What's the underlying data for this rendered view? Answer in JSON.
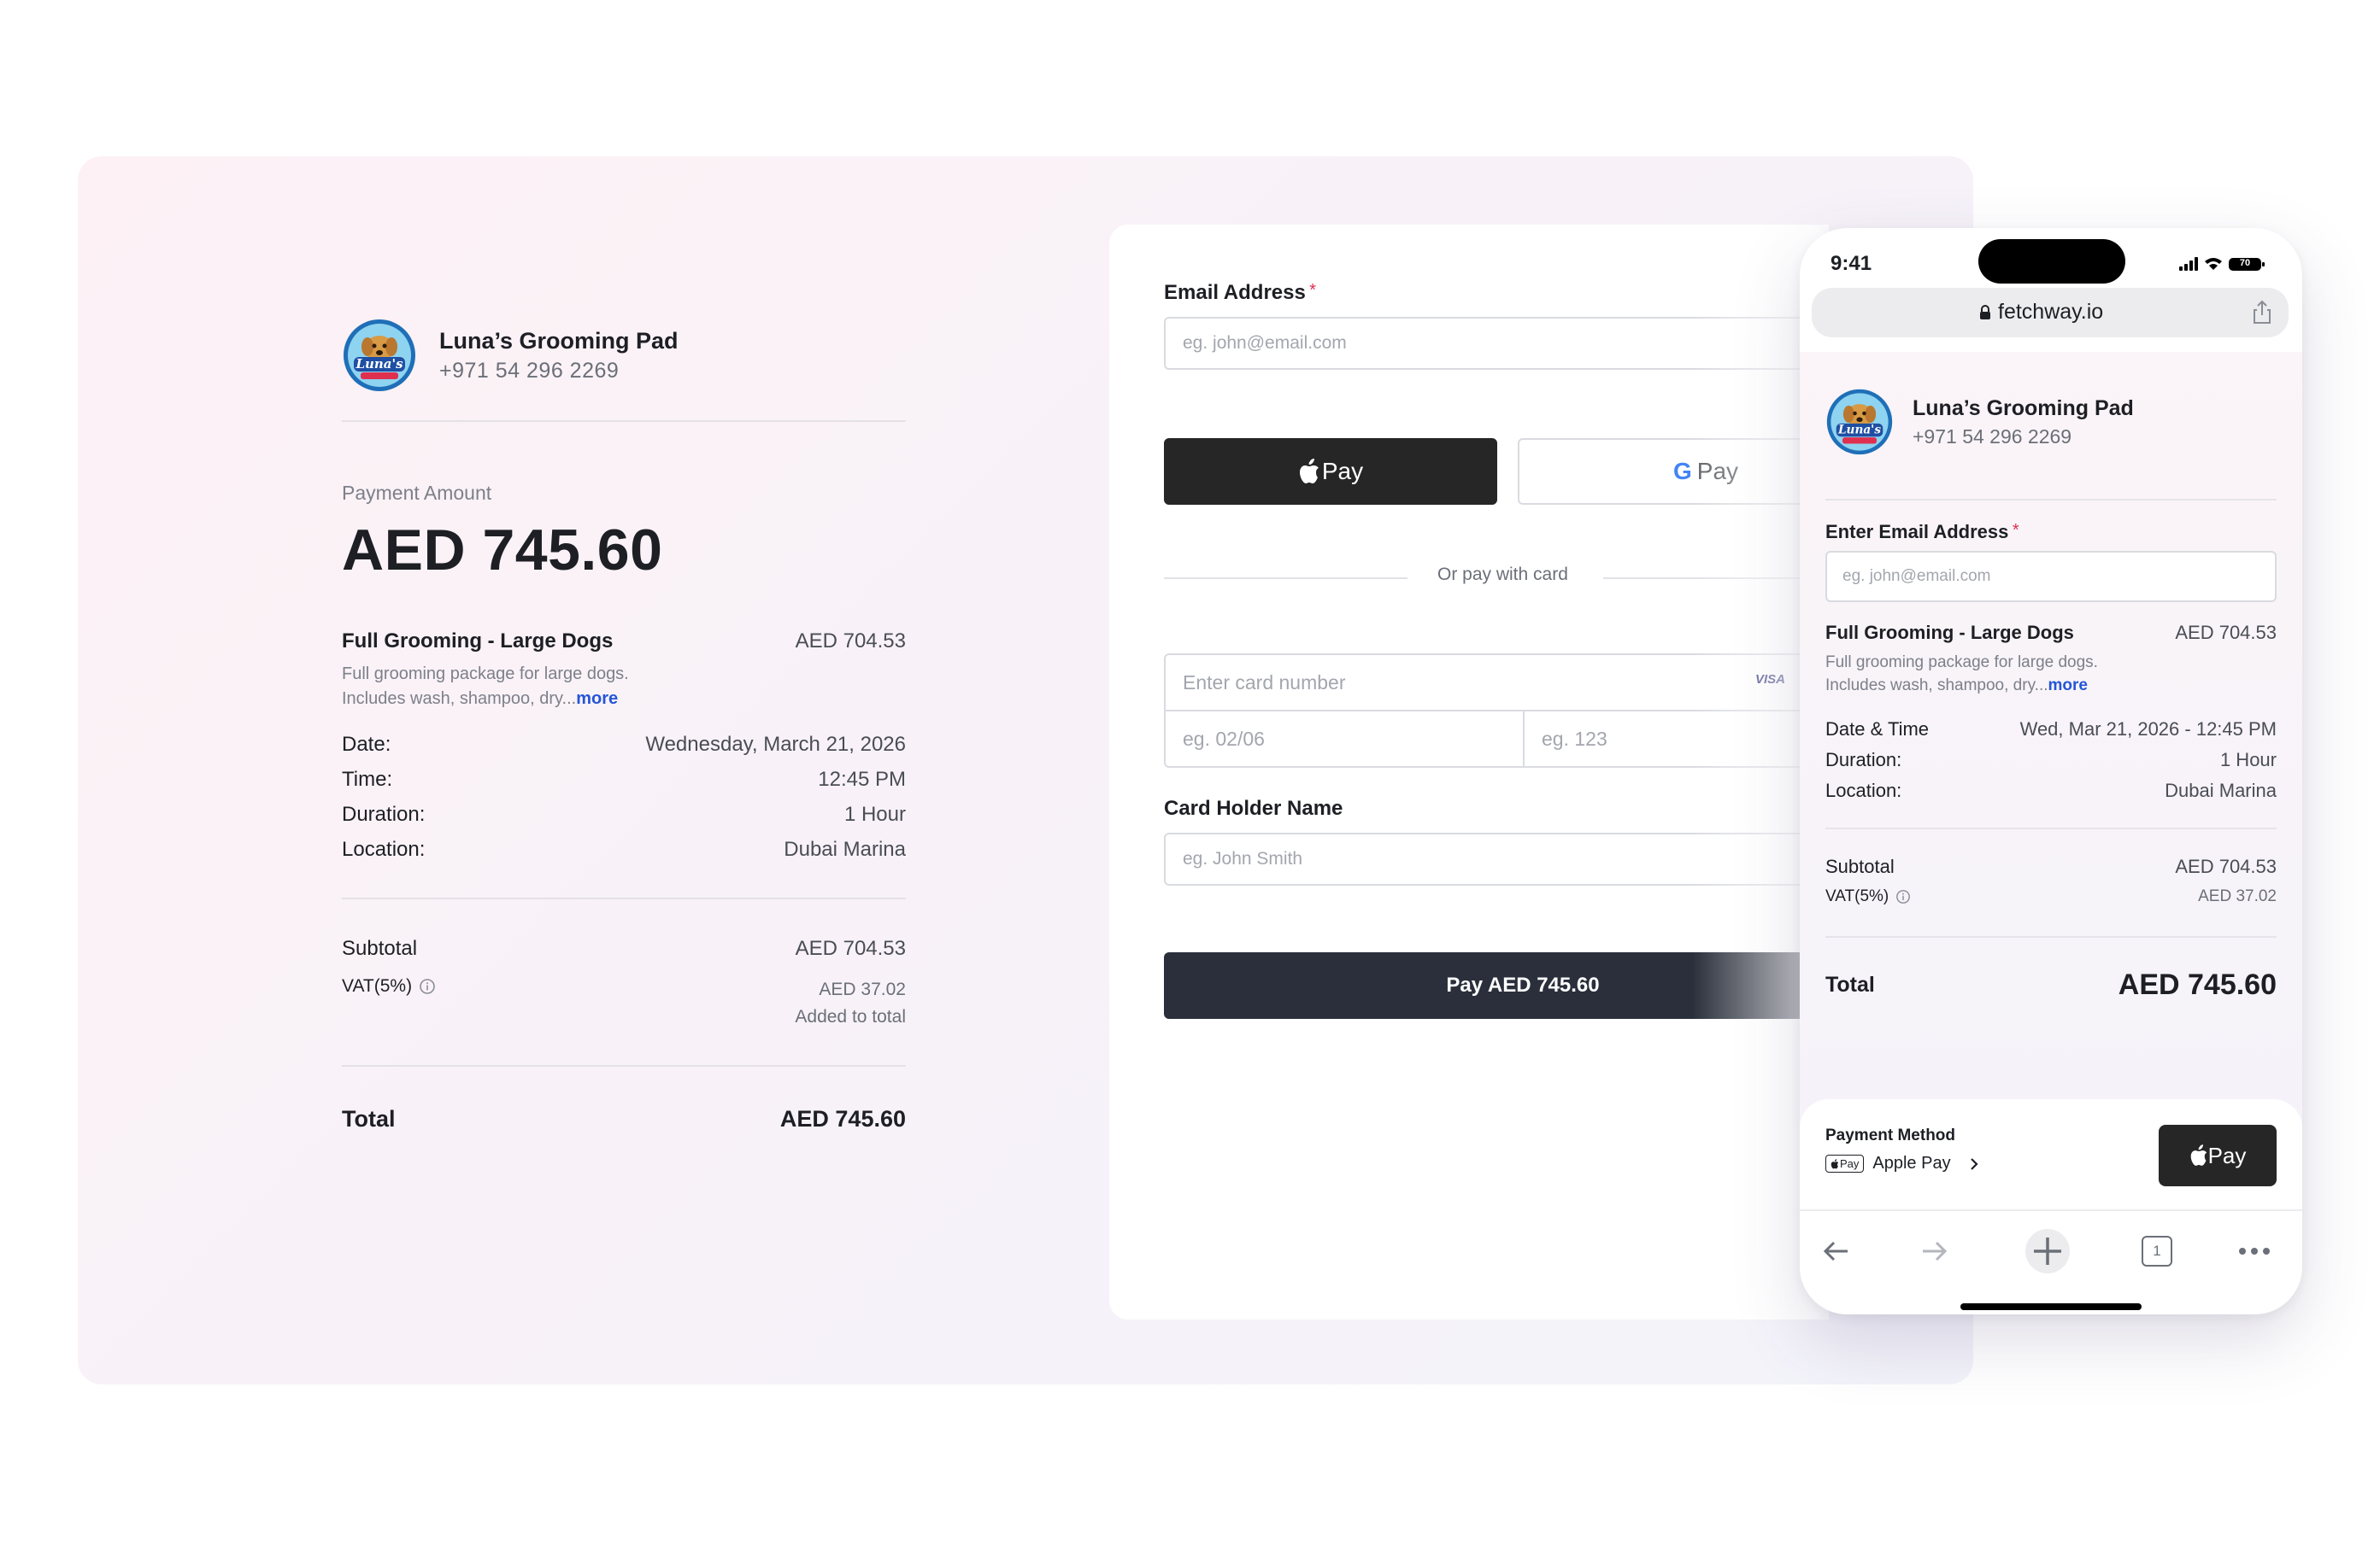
{
  "merchant": {
    "name": "Luna’s Grooming Pad",
    "phone": "+971 54 296 2269",
    "logo_text": "Luna's"
  },
  "summary": {
    "payment_amount_label": "Payment Amount",
    "payment_amount": "AED 745.60",
    "service": {
      "title": "Full Grooming - Large Dogs",
      "price": "AED 704.53",
      "desc_line1": "Full grooming package for large dogs.",
      "desc_line2": "Includes wash, shampoo, dry...",
      "more": "more"
    },
    "details": [
      {
        "label": "Date:",
        "value": "Wednesday, March 21, 2026"
      },
      {
        "label": "Time:",
        "value": "12:45 PM"
      },
      {
        "label": "Duration:",
        "value": "1 Hour"
      },
      {
        "label": "Location:",
        "value": "Dubai Marina"
      }
    ],
    "subtotal_label": "Subtotal",
    "subtotal_value": "AED 704.53",
    "vat_label": "VAT(5%)",
    "vat_value": "AED 37.02",
    "vat_note": "Added to total",
    "total_label": "Total",
    "total_value": "AED 745.60"
  },
  "form": {
    "email_label": "Email Address",
    "required_mark": "*",
    "email_placeholder": "eg. john@email.com",
    "apple_pay_label": "Pay",
    "google_pay_label": "Pay",
    "divider_text": "Or pay with card",
    "card_number_placeholder": "Enter card number",
    "card_brand": "VISA",
    "expiry_placeholder": "eg. 02/06",
    "cvc_placeholder": "eg. 123",
    "card_holder_label": "Card Holder Name",
    "card_holder_placeholder": "eg. John Smith",
    "pay_button": "Pay AED 745.60"
  },
  "phone": {
    "time": "9:41",
    "battery": "70",
    "url": "fetchway.io",
    "email_label": "Enter Email Address",
    "email_placeholder": "eg. john@email.com",
    "service_title": "Full Grooming - Large Dogs",
    "service_price": "AED 704.53",
    "desc_line1": "Full grooming package for large dogs.",
    "desc_line2": "Includes wash, shampoo, dry...",
    "more": "more",
    "details": [
      {
        "label": "Date & Time",
        "value": "Wed, Mar 21, 2026 - 12:45 PM"
      },
      {
        "label": "Duration:",
        "value": "1 Hour"
      },
      {
        "label": "Location:",
        "value": "Dubai Marina"
      }
    ],
    "subtotal_label": "Subtotal",
    "subtotal_value": "AED 704.53",
    "vat_label": "VAT(5%)",
    "vat_value": "AED 37.02",
    "total_label": "Total",
    "total_value": "AED 745.60",
    "payment_method_label": "Payment Method",
    "payment_method_badge": "Pay",
    "payment_method_value": "Apple Pay",
    "pay_button": "Pay",
    "tab_count": "1"
  },
  "colors": {
    "accent_link": "#2456d6",
    "required": "#e0304f",
    "pay_button": "#2a2f3b",
    "apple_pay": "#262626"
  }
}
